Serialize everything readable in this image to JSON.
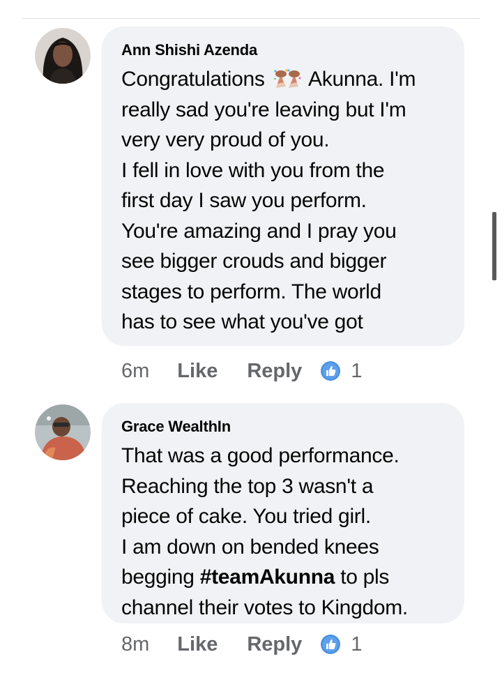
{
  "comments": [
    {
      "author": "Ann Shishi Azenda",
      "avatar_icon": "profile-photo-icon",
      "lines": [
        {
          "before": "Congratulations ",
          "emoji": "party-popper-icon",
          "after": " Akunna. I'm"
        },
        {
          "text": "really sad you're leaving but I'm"
        },
        {
          "text": "very very proud of you."
        },
        {
          "text": "I fell in love with you from the"
        },
        {
          "text": "first day I saw you perform."
        },
        {
          "text": "You're amazing and I pray you"
        },
        {
          "text": "see bigger crouds and bigger"
        },
        {
          "text": "stages to perform.  The world"
        },
        {
          "text": "has to see what you've got"
        }
      ],
      "time": "6m",
      "like_label": "Like",
      "reply_label": "Reply",
      "reaction_icon": "thumbs-up-icon",
      "reaction_count": "1"
    },
    {
      "author": "Grace WealthIn",
      "avatar_icon": "profile-photo-icon",
      "lines": [
        {
          "text": "That was a good performance."
        },
        {
          "text": "Reaching the top 3 wasn't a"
        },
        {
          "text": "piece of cake. You tried girl."
        },
        {
          "text": "I am down on bended knees"
        },
        {
          "before": "begging ",
          "hashtag": "#teamAkunna",
          "after": " to pls"
        },
        {
          "text": "channel their votes to Kingdom."
        }
      ],
      "time": "8m",
      "like_label": "Like",
      "reply_label": "Reply",
      "reaction_icon": "thumbs-up-icon",
      "reaction_count": "1"
    }
  ],
  "colors": {
    "bubble": "#f0f2f5",
    "meta_text": "#65676b",
    "like_blue": "#1877f2"
  }
}
